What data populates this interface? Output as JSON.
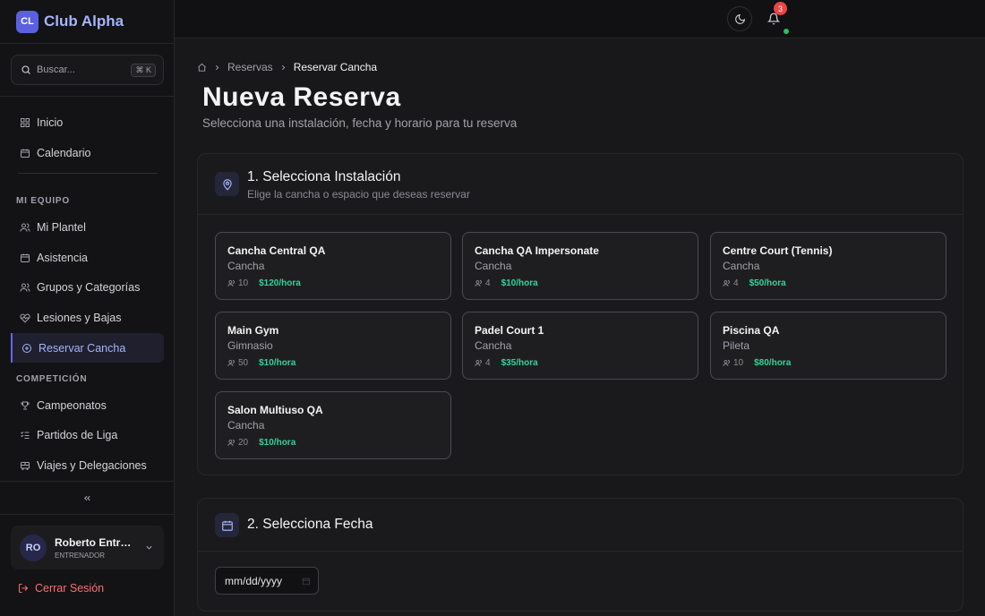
{
  "brand": {
    "logo": "CL",
    "name": "Club Alpha"
  },
  "search": {
    "placeholder": "Buscar...",
    "shortcut": "⌘ K"
  },
  "sidebar": {
    "main_items": [
      {
        "label": "Inicio",
        "icon": "grid-icon"
      },
      {
        "label": "Calendario",
        "icon": "calendar-icon"
      }
    ],
    "section_team": "MI EQUIPO",
    "team_items": [
      {
        "label": "Mi Plantel",
        "icon": "users-icon"
      },
      {
        "label": "Asistencia",
        "icon": "calendar-check-icon"
      },
      {
        "label": "Grupos y Categorías",
        "icon": "users-group-icon"
      },
      {
        "label": "Lesiones y Bajas",
        "icon": "heart-pulse-icon"
      },
      {
        "label": "Reservar Cancha",
        "icon": "plus-circle-icon",
        "active": true
      }
    ],
    "section_competition": "COMPETICIÓN",
    "competition_items": [
      {
        "label": "Campeonatos",
        "icon": "trophy-icon"
      },
      {
        "label": "Partidos de Liga",
        "icon": "list-icon"
      },
      {
        "label": "Viajes y Delegaciones",
        "icon": "bus-icon"
      }
    ],
    "collapse_icon": "chevrons-left-icon"
  },
  "user": {
    "initials": "RO",
    "name": "Roberto Entrenador",
    "role": "ENTRENADOR"
  },
  "logout_label": "Cerrar Sesión",
  "header": {
    "notification_count": "3",
    "theme_icon": "moon-icon",
    "bell_icon": "bell-icon"
  },
  "breadcrumb": {
    "parent": "Reservas",
    "current": "Reservar Cancha"
  },
  "page": {
    "title": "Nueva Reserva",
    "subtitle": "Selecciona una instalación, fecha y horario para tu reserva"
  },
  "step1": {
    "title": "1. Selecciona Instalación",
    "description": "Elige la cancha o espacio que deseas reservar",
    "facilities": [
      {
        "name": "Cancha Central QA",
        "type": "Cancha",
        "capacity": "10",
        "price": "$120/hora"
      },
      {
        "name": "Cancha QA Impersonate",
        "type": "Cancha",
        "capacity": "4",
        "price": "$10/hora"
      },
      {
        "name": "Centre Court (Tennis)",
        "type": "Cancha",
        "capacity": "4",
        "price": "$50/hora"
      },
      {
        "name": "Main Gym",
        "type": "Gimnasio",
        "capacity": "50",
        "price": "$10/hora"
      },
      {
        "name": "Padel Court 1",
        "type": "Cancha",
        "capacity": "4",
        "price": "$35/hora"
      },
      {
        "name": "Piscina QA",
        "type": "Pileta",
        "capacity": "10",
        "price": "$80/hora"
      },
      {
        "name": "Salon Multiuso QA",
        "type": "Cancha",
        "capacity": "20",
        "price": "$10/hora"
      }
    ]
  },
  "step2": {
    "title": "2. Selecciona Fecha",
    "date_placeholder": "mm/dd/yyyy"
  },
  "colors": {
    "accent": "#6366f1",
    "price": "#34d399",
    "danger": "#f87171",
    "brand": "#a5b4fc"
  }
}
